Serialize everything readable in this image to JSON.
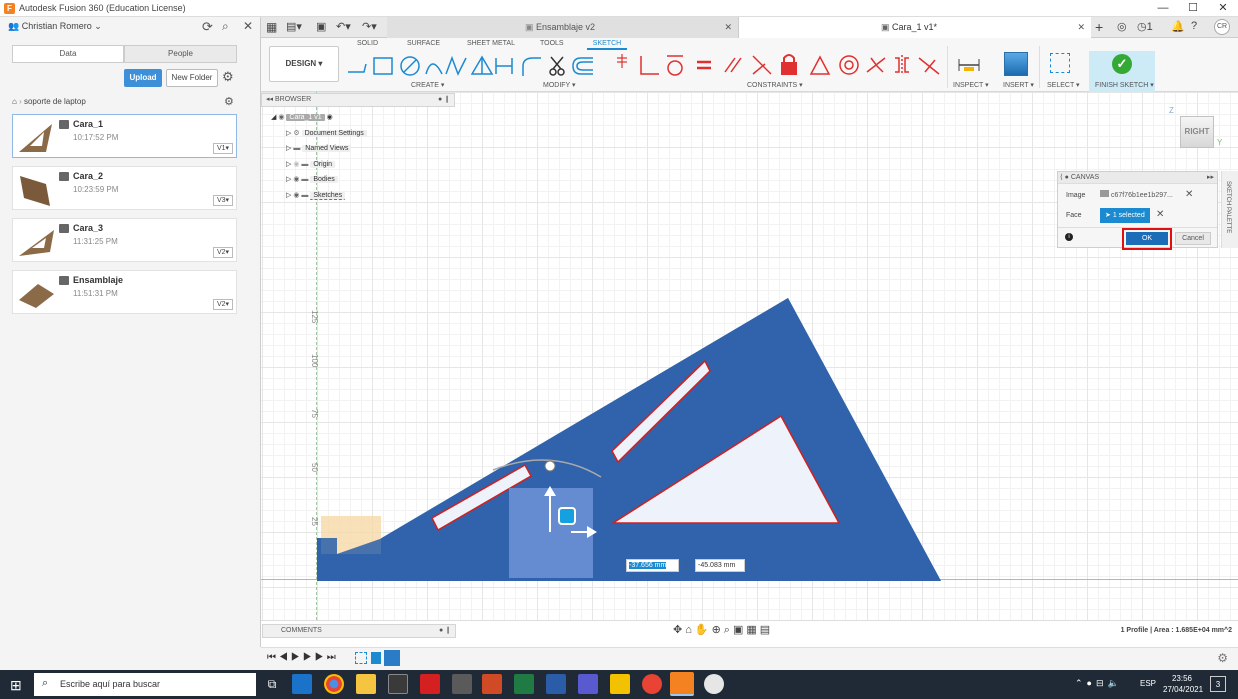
{
  "window": {
    "title": "Autodesk Fusion 360 (Education License)",
    "min": "—",
    "max": "☐",
    "close": "✕"
  },
  "left_panel": {
    "user_name": "Christian Romero",
    "user_caret": "⌄",
    "tabs": [
      "Data",
      "People"
    ],
    "upload_label": "Upload",
    "new_folder_label": "New Folder",
    "breadcrumb": "soporte de laptop",
    "files": [
      {
        "name": "Cara_1",
        "time": "10:17:52 PM",
        "version": "V1▾"
      },
      {
        "name": "Cara_2",
        "time": "10:23:59 PM",
        "version": "V3▾"
      },
      {
        "name": "Cara_3",
        "time": "11:31:25 PM",
        "version": "V2▾"
      },
      {
        "name": "Ensamblaje",
        "time": "11:51:31 PM",
        "version": "V2▾"
      }
    ]
  },
  "doc_tabs": [
    {
      "label": "Ensamblaje v2",
      "close": "✕"
    },
    {
      "label": "Cara_1 v1*",
      "close": "✕"
    }
  ],
  "header_right": {
    "notif_count": "1",
    "user_initials": "CR"
  },
  "toolbar": {
    "workspace": "DESIGN ▾",
    "tabs": [
      "SOLID",
      "SURFACE",
      "SHEET METAL",
      "TOOLS",
      "SKETCH"
    ],
    "groups": {
      "create": "CREATE ▾",
      "modify": "MODIFY ▾",
      "constraints": "CONSTRAINTS ▾",
      "inspect": "INSPECT ▾",
      "insert": "INSERT ▾",
      "select": "SELECT ▾",
      "finish": "FINISH SKETCH ▾"
    }
  },
  "browser": {
    "header": "BROWSER",
    "root": "Cara_1 v1",
    "items": [
      "Document Settings",
      "Named Views",
      "Origin",
      "Bodies",
      "Sketches"
    ]
  },
  "viewcube": {
    "face": "RIGHT",
    "z": "Z",
    "y": "Y"
  },
  "canvas_dialog": {
    "header": "CANVAS",
    "image_label": "Image",
    "image_value": "c67f76b1ee1b297...",
    "face_label": "Face",
    "face_value": "1 selected",
    "ok_label": "OK",
    "cancel_label": "Cancel",
    "side_palette": "SKETCH PALETTE"
  },
  "ruler_labels": [
    "125",
    "100",
    "75",
    "50",
    "25"
  ],
  "inputs": {
    "dx": "-37.656 mm",
    "dy": "-45.083 mm"
  },
  "status": {
    "comments_label": "COMMENTS",
    "profile_info": "1 Profile | Area : 1.685E+04 mm^2"
  },
  "taskbar": {
    "search_placeholder": "Escribe aquí para buscar",
    "lang": "ESP",
    "time": "23:56",
    "date": "27/04/2021",
    "notif": "3"
  },
  "colors": {
    "accent": "#1c8ad0",
    "sketch_tab": "#1c8ad0",
    "finish_bg": "#cdeaf7",
    "canvas_blue": "#2e5ea8",
    "highlight_red": "#e01010",
    "taskbar": "#1f2a36"
  }
}
